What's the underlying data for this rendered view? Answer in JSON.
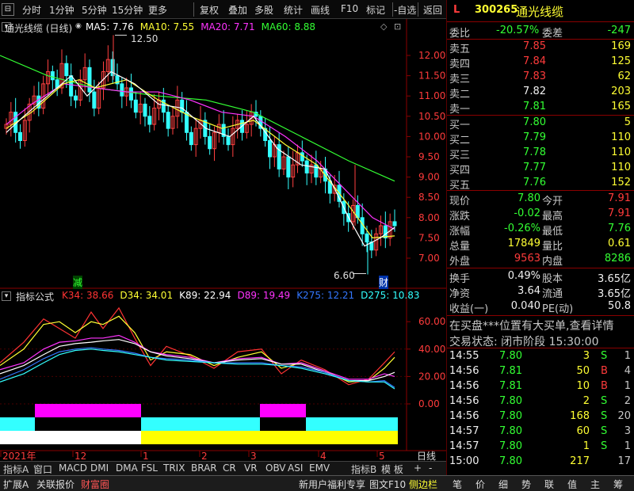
{
  "toolbar": {
    "items": [
      "分时",
      "1分钟",
      "5分钟",
      "15分钟",
      "更多",
      "复权",
      "叠加",
      "多股",
      "统计",
      "画线",
      "F10",
      "标记",
      "-自选",
      "返回"
    ]
  },
  "stock": {
    "flag": "L",
    "code": "300265",
    "name": "通光线缆"
  },
  "main_chart": {
    "title": "通光线缆 (日线)",
    "ma": [
      {
        "label": "MA5: 7.76",
        "color": "#ffffff"
      },
      {
        "label": "MA10: 7.55",
        "color": "#ffff33"
      },
      {
        "label": "MA20: 7.71",
        "color": "#ff33ff"
      },
      {
        "label": "MA60: 8.88",
        "color": "#33ff33"
      }
    ],
    "price_axis": [
      "12.00",
      "11.50",
      "11.00",
      "10.50",
      "10.00",
      "9.50",
      "9.00",
      "8.50",
      "8.00",
      "7.50",
      "7.00"
    ],
    "high_label": "12.50",
    "low_label": "6.60",
    "marker_jian": "减",
    "marker_cai": "财"
  },
  "indicator": {
    "title": "指标公式",
    "values": [
      {
        "label": "K34: 38.66",
        "color": "#ff3333"
      },
      {
        "label": "D34: 34.01",
        "color": "#ffff33"
      },
      {
        "label": "K89: 22.94",
        "color": "#ffffff"
      },
      {
        "label": "D89: 19.49",
        "color": "#ff33ff"
      },
      {
        "label": "K275: 12.21",
        "color": "#3377ff"
      },
      {
        "label": "D275: 10.83",
        "color": "#33ffff"
      }
    ],
    "axis": [
      "60.00",
      "40.00",
      "20.00",
      "0.00"
    ]
  },
  "x_axis": {
    "labels": [
      "2021年",
      "12",
      "1",
      "2",
      "3",
      "4",
      "5"
    ],
    "period": "日线"
  },
  "tabs": [
    "指标A",
    "窗口",
    "MACD",
    "DMI",
    "DMA",
    "FSL",
    "TRIX",
    "BRAR",
    "CR",
    "VR",
    "OBV",
    "ASI",
    "EMV",
    "指标B",
    "模 板",
    "+",
    "-"
  ],
  "statusbar": {
    "left": [
      "扩展A",
      "关联报价",
      "财富圈"
    ],
    "promo": "新用户福利专享",
    "right_btns": [
      "图文F10",
      "侧边栏"
    ],
    "panel_tabs": [
      "笔",
      "价",
      "细",
      "势",
      "联",
      "值",
      "主",
      "筹"
    ]
  },
  "quote": {
    "weibi_label": "委比",
    "weibi": "-20.57%",
    "weicha_label": "委差",
    "weicha": "-247",
    "sells": [
      {
        "label": "卖五",
        "price": "7.85",
        "vol": "169"
      },
      {
        "label": "卖四",
        "price": "7.84",
        "vol": "125"
      },
      {
        "label": "卖三",
        "price": "7.83",
        "vol": "62"
      },
      {
        "label": "卖二",
        "price": "7.82",
        "vol": "203"
      },
      {
        "label": "卖一",
        "price": "7.81",
        "vol": "165"
      }
    ],
    "buys": [
      {
        "label": "买一",
        "price": "7.80",
        "vol": "5"
      },
      {
        "label": "买二",
        "price": "7.79",
        "vol": "110"
      },
      {
        "label": "买三",
        "price": "7.78",
        "vol": "110"
      },
      {
        "label": "买四",
        "price": "7.77",
        "vol": "110"
      },
      {
        "label": "买五",
        "price": "7.76",
        "vol": "152"
      }
    ],
    "stats": [
      {
        "l1": "现价",
        "v1": "7.80",
        "c1": "green",
        "l2": "今开",
        "v2": "7.91",
        "c2": "red"
      },
      {
        "l1": "涨跌",
        "v1": "-0.02",
        "c1": "green",
        "l2": "最高",
        "v2": "7.91",
        "c2": "red"
      },
      {
        "l1": "涨幅",
        "v1": "-0.26%",
        "c1": "green",
        "l2": "最低",
        "v2": "7.76",
        "c2": "green"
      },
      {
        "l1": "总量",
        "v1": "17849",
        "c1": "yellow",
        "l2": "量比",
        "v2": "0.61",
        "c2": "yellow"
      },
      {
        "l1": "外盘",
        "v1": "9563",
        "c1": "red",
        "l2": "内盘",
        "v2": "8286",
        "c2": "green"
      }
    ],
    "stats2": [
      {
        "l1": "换手",
        "v1": "0.49%",
        "l2": "股本",
        "v2": "3.65亿"
      },
      {
        "l1": "净资",
        "v1": "3.64",
        "l2": "流通",
        "v2": "3.65亿"
      },
      {
        "l1": "收益(一)",
        "v1": "0.040",
        "l2": "PE(动)",
        "v2": "50.8"
      }
    ],
    "notice": "在买盘***位置有大买单,查看详情",
    "trade_state": "交易状态: 闭市阶段  15:30:00",
    "ticks": [
      {
        "t": "14:55",
        "p": "7.80",
        "v": "3",
        "s": "S",
        "c": "green",
        "n": "1"
      },
      {
        "t": "14:56",
        "p": "7.81",
        "v": "50",
        "s": "B",
        "c": "red",
        "n": "4"
      },
      {
        "t": "14:56",
        "p": "7.81",
        "v": "10",
        "s": "B",
        "c": "red",
        "n": "1"
      },
      {
        "t": "14:56",
        "p": "7.80",
        "v": "2",
        "s": "S",
        "c": "green",
        "n": "2"
      },
      {
        "t": "14:56",
        "p": "7.80",
        "v": "168",
        "s": "S",
        "c": "green",
        "n": "20"
      },
      {
        "t": "14:57",
        "p": "7.80",
        "v": "60",
        "s": "S",
        "c": "green",
        "n": "3"
      },
      {
        "t": "14:57",
        "p": "7.80",
        "v": "1",
        "s": "S",
        "c": "green",
        "n": "1"
      },
      {
        "t": "15:00",
        "p": "7.80",
        "v": "217",
        "s": "",
        "c": "gray",
        "n": "17"
      }
    ]
  }
}
